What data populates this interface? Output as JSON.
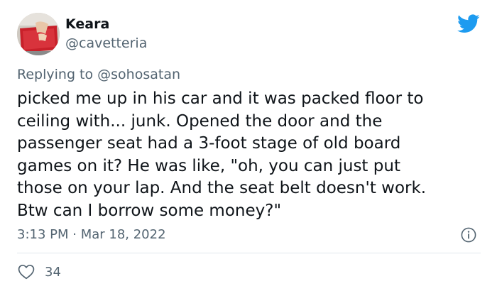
{
  "author": {
    "name": "Keara",
    "handle": "@cavetteria",
    "avatar_icon": "profile-photo"
  },
  "brand": {
    "icon": "twitter-bird-icon",
    "color": "#1d9bf0"
  },
  "reply": {
    "prefix": "Replying to ",
    "mention": "@sohosatan"
  },
  "tweet": {
    "lines": [
      "picked me up in his car and it was packed floor to",
      "ceiling with... junk. Opened the door and the",
      "passenger seat had a 3-foot stage of old board",
      "games on it? He was like, \"oh, you can just put",
      "those on your lap. And the seat belt doesn't work.",
      "Btw can I borrow some money?\""
    ]
  },
  "meta": {
    "timestamp": "3:13 PM · Mar 18, 2022",
    "info_icon": "info-icon"
  },
  "engagement": {
    "likes": "34",
    "like_icon": "heart-icon"
  },
  "colors": {
    "text_primary": "#0f1419",
    "text_secondary": "#536471",
    "divider": "#e1e8ed"
  }
}
